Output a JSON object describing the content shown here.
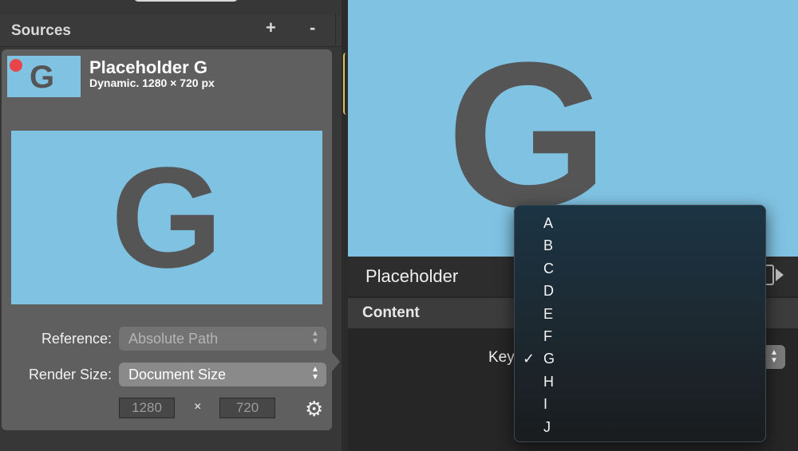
{
  "sources": {
    "title": "Sources",
    "add_label": "+",
    "remove_label": "-"
  },
  "card": {
    "thumb_letter": "G",
    "title": "Placeholder G",
    "subtitle": "Dynamic. 1280 × 720 px",
    "preview_letter": "G",
    "reference_label": "Reference:",
    "reference_value": "Absolute Path",
    "render_size_label": "Render Size:",
    "render_size_value": "Document Size",
    "width_value": "1280",
    "height_value": "720",
    "times_symbol": "×",
    "arrows_glyph": "⌃⌄",
    "gear_glyph": "⚙"
  },
  "inspector": {
    "preview_letter": "G",
    "title": "Placeholder",
    "content_title": "Content",
    "key_label": "Key"
  },
  "menu": {
    "check_glyph": "✓",
    "selected_index": 6,
    "items": [
      "A",
      "B",
      "C",
      "D",
      "E",
      "F",
      "G",
      "H",
      "I",
      "J"
    ]
  },
  "colors": {
    "preview_blue": "#80c2e2",
    "letter_gray": "#555555",
    "record_red": "#e8454b",
    "panel_gray": "#5f5f5f",
    "menu_top": "#1b3444"
  }
}
